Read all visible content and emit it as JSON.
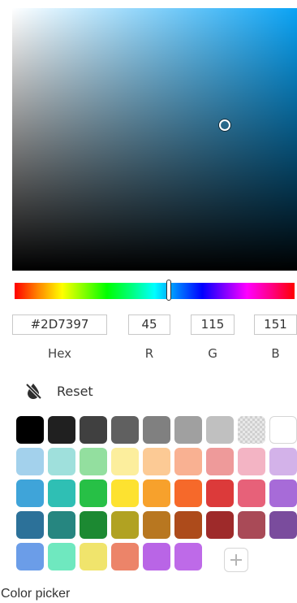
{
  "picker": {
    "hue_degrees": 201,
    "saturation_percent": 71,
    "value_percent": 59,
    "hue_base_color": "#0aa3f5"
  },
  "fields": {
    "hex": {
      "value": "#2D7397",
      "label": "Hex"
    },
    "r": {
      "value": "45",
      "label": "R"
    },
    "g": {
      "value": "115",
      "label": "G"
    },
    "b": {
      "value": "151",
      "label": "B"
    }
  },
  "reset": {
    "label": "Reset",
    "icon": "no-color-drop-icon"
  },
  "swatches": [
    [
      "#000000",
      "#202020",
      "#404040",
      "#606060",
      "#808080",
      "#a0a0a0",
      "#c0c0c0",
      "checker",
      "#ffffff"
    ],
    [
      "#a3d1ec",
      "#9fe0dc",
      "#93df9f",
      "#fcee9d",
      "#fcca95",
      "#f9b192",
      "#ee9a9a",
      "#f3b4c4",
      "#d3b2e9"
    ],
    [
      "#3fa4d9",
      "#2fbfb4",
      "#27c046",
      "#fde230",
      "#f7a12c",
      "#f6692a",
      "#dc3a3a",
      "#e76179",
      "#a76bd8"
    ],
    [
      "#2c7199",
      "#268680",
      "#1c8932",
      "#b1a222",
      "#b87720",
      "#ad4b1b",
      "#9e2a2a",
      "#a94a57",
      "#7a4c9d"
    ],
    [
      "#6b9de8",
      "#6fe8bf",
      "#f0e46c",
      "#ec8469",
      "#b965e6",
      "#be6ae8"
    ]
  ],
  "add_icon": "plus-icon",
  "caption": "Color picker"
}
